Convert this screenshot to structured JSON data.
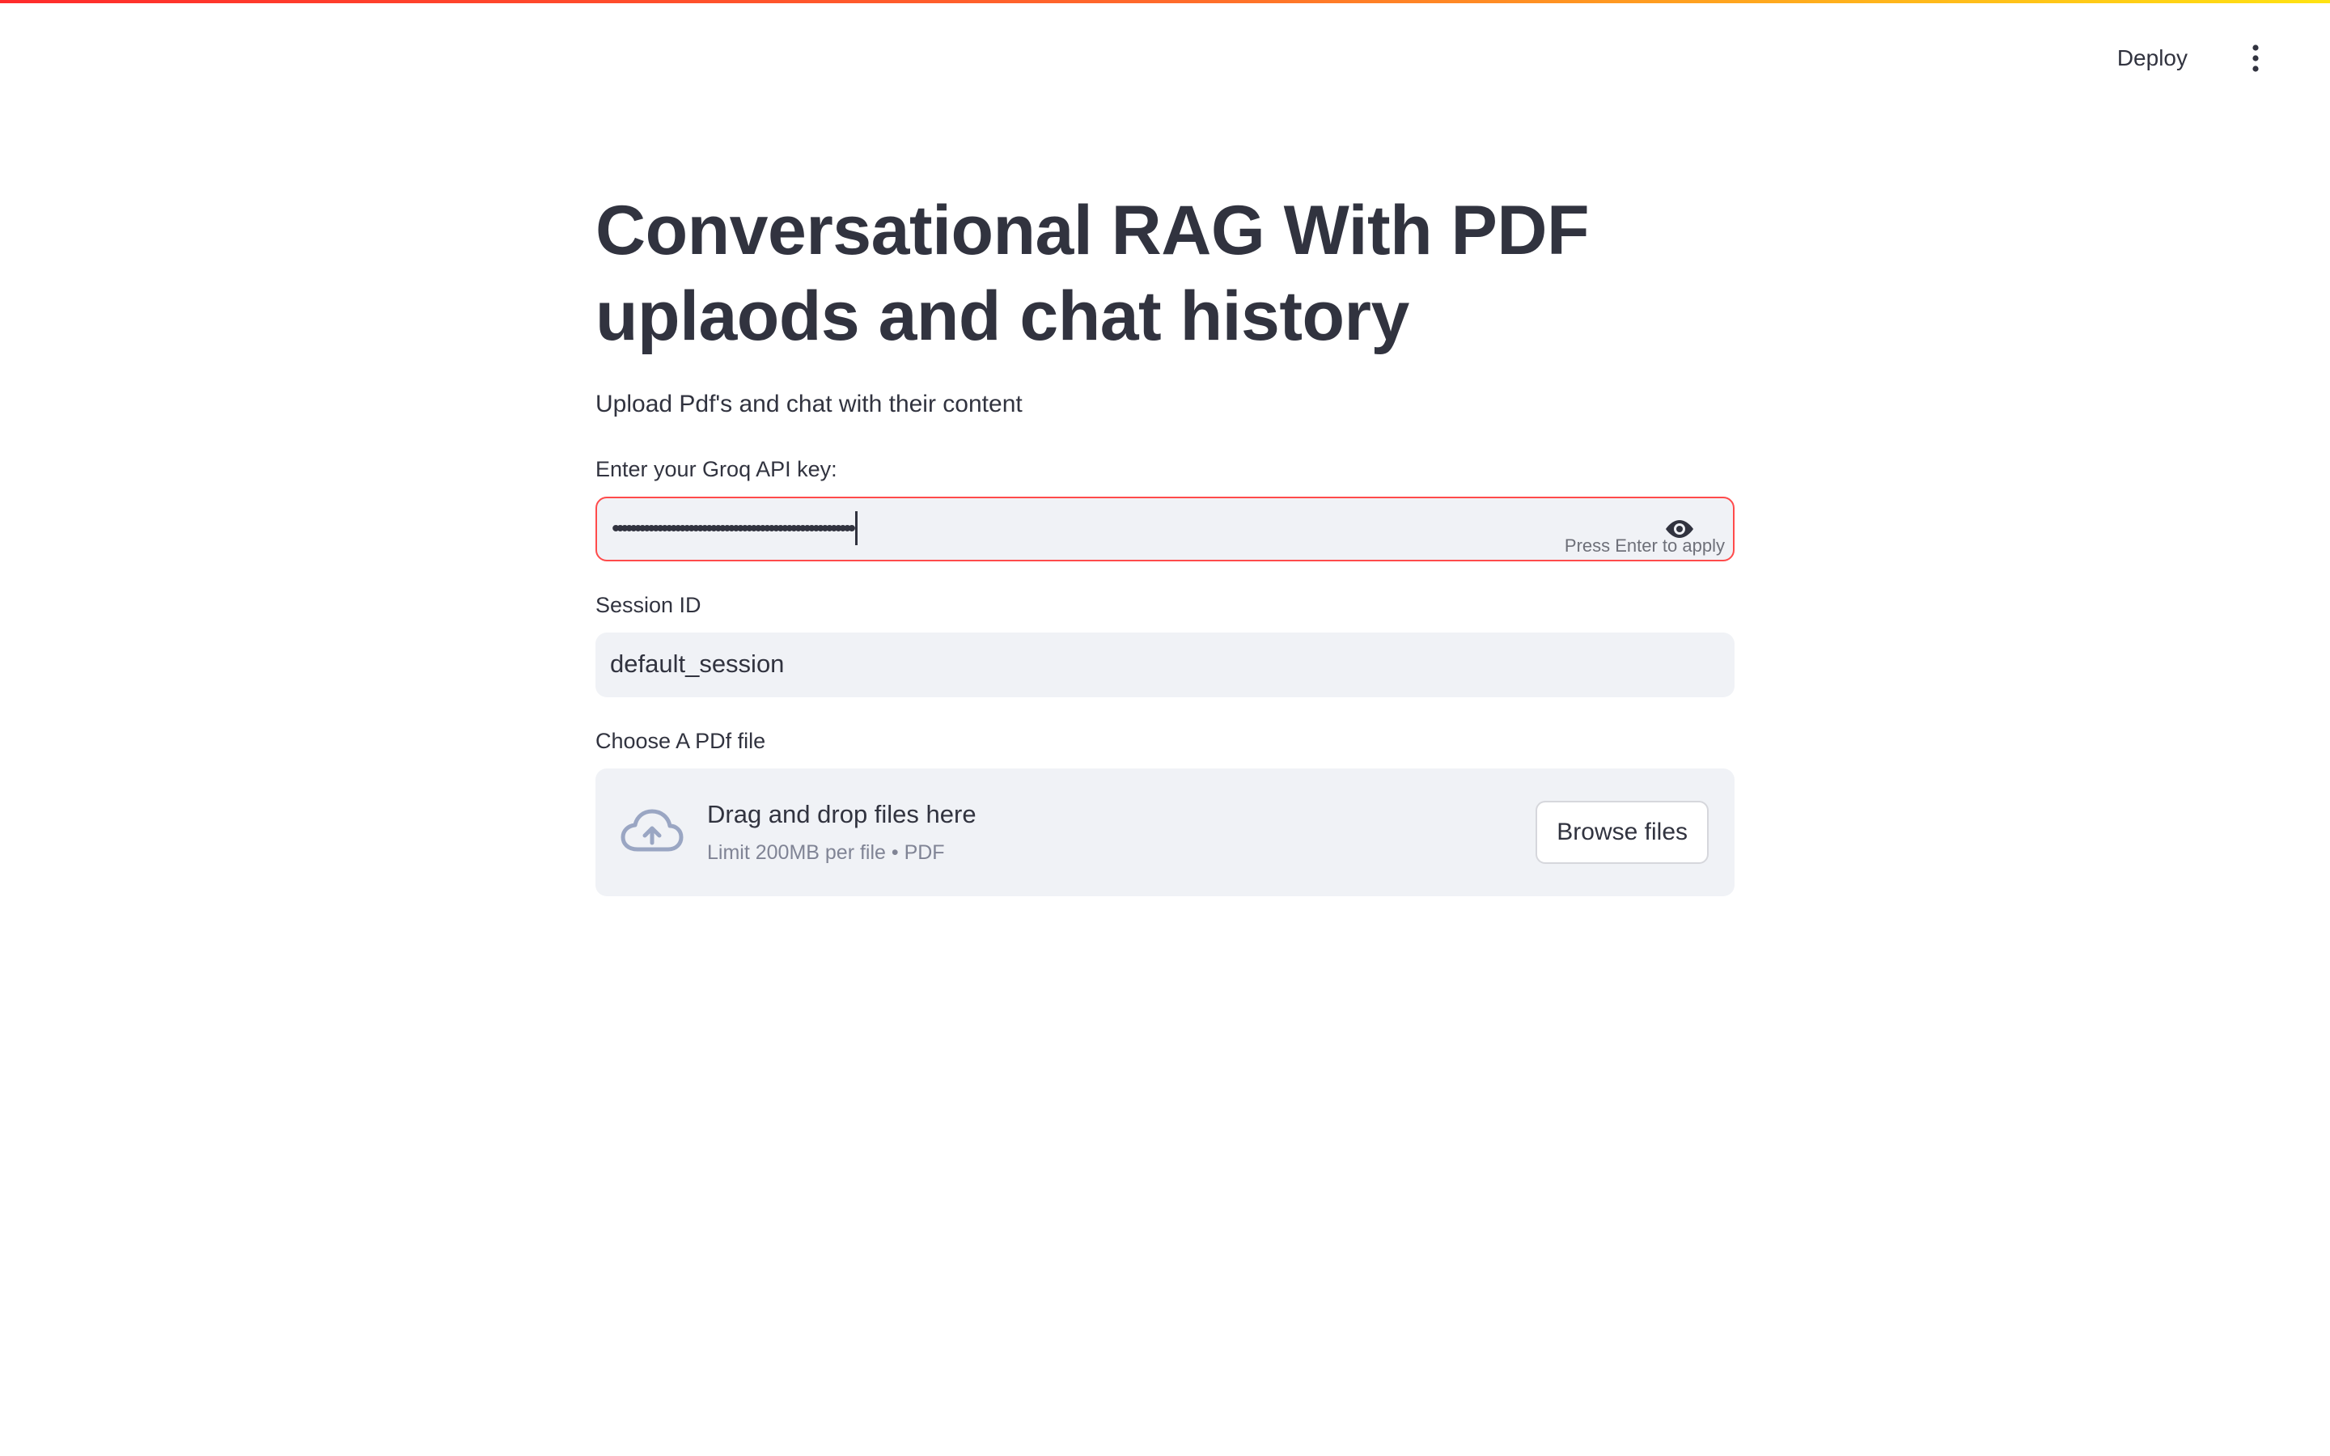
{
  "header": {
    "deploy_label": "Deploy",
    "menu_icon": "vertical-ellipsis-icon"
  },
  "main": {
    "title": "Conversational RAG With PDF uplaods and chat history",
    "subtitle": "Upload Pdf's and chat with their content",
    "api_key": {
      "label": "Enter your Groq API key:",
      "masked_value": "••••••••••••••••••••••••••••••••••••••••••••••••••••••",
      "hint": "Press Enter to apply",
      "visibility_icon": "eye-icon",
      "error_border_color": "#ff4b4b"
    },
    "session": {
      "label": "Session ID",
      "value": "default_session"
    },
    "uploader": {
      "label": "Choose A PDf file",
      "drop_text": "Drag and drop files here",
      "limit_text": "Limit 200MB per file • PDF",
      "icon": "cloud-upload-icon",
      "browse_label": "Browse files"
    }
  },
  "colors": {
    "text": "#31333f",
    "input_bg": "#f0f2f6",
    "accent_red": "#ff4b4b",
    "muted": "#808495"
  }
}
